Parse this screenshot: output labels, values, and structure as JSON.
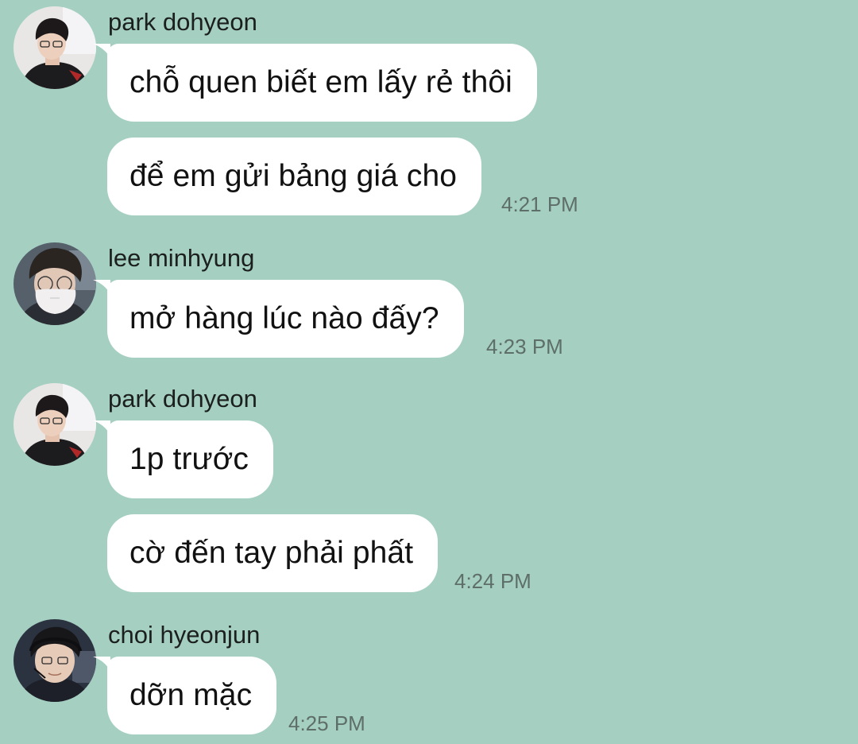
{
  "colors": {
    "background": "#a5cfc1",
    "bubble": "#ffffff",
    "timestamp": "#5e6e69"
  },
  "chat": {
    "groups": [
      {
        "sender": "park dohyeon",
        "avatar": "profile-photo-park-dohyeon",
        "messages": [
          {
            "text": "chỗ quen biết em lấy rẻ thôi",
            "time": ""
          },
          {
            "text": "để em gửi bảng giá cho",
            "time": "4:21 PM"
          }
        ]
      },
      {
        "sender": "lee minhyung",
        "avatar": "profile-photo-lee-minhyung",
        "messages": [
          {
            "text": "mở hàng lúc nào đấy?",
            "time": "4:23 PM"
          }
        ]
      },
      {
        "sender": "park dohyeon",
        "avatar": "profile-photo-park-dohyeon",
        "messages": [
          {
            "text": "1p trước",
            "time": ""
          },
          {
            "text": "cờ đến tay phải phất",
            "time": "4:24 PM"
          }
        ]
      },
      {
        "sender": "choi hyeonjun",
        "avatar": "profile-photo-choi-hyeonjun",
        "messages": [
          {
            "text": "dỡn mặc",
            "time": "4:25 PM"
          }
        ]
      }
    ]
  }
}
